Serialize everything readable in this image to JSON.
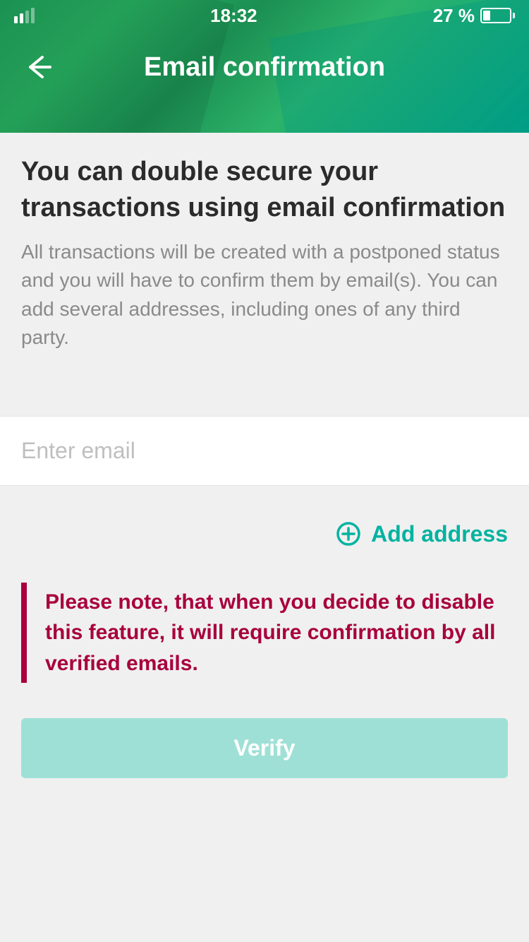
{
  "status_bar": {
    "time": "18:32",
    "battery_percent": "27 %"
  },
  "header": {
    "title": "Email confirmation"
  },
  "content": {
    "heading": "You can double secure your transactions using email confirmation",
    "description": "All transactions will be created with a postponed status and you will have to confirm them by email(s). You can add several addresses, including ones of any third party."
  },
  "input": {
    "placeholder": "Enter email",
    "value": ""
  },
  "add_address": {
    "label": "Add address"
  },
  "note": {
    "text": "Please note, that when you decide to disable this feature, it will require confirmation by all verified emails."
  },
  "verify_button": {
    "label": "Verify"
  }
}
